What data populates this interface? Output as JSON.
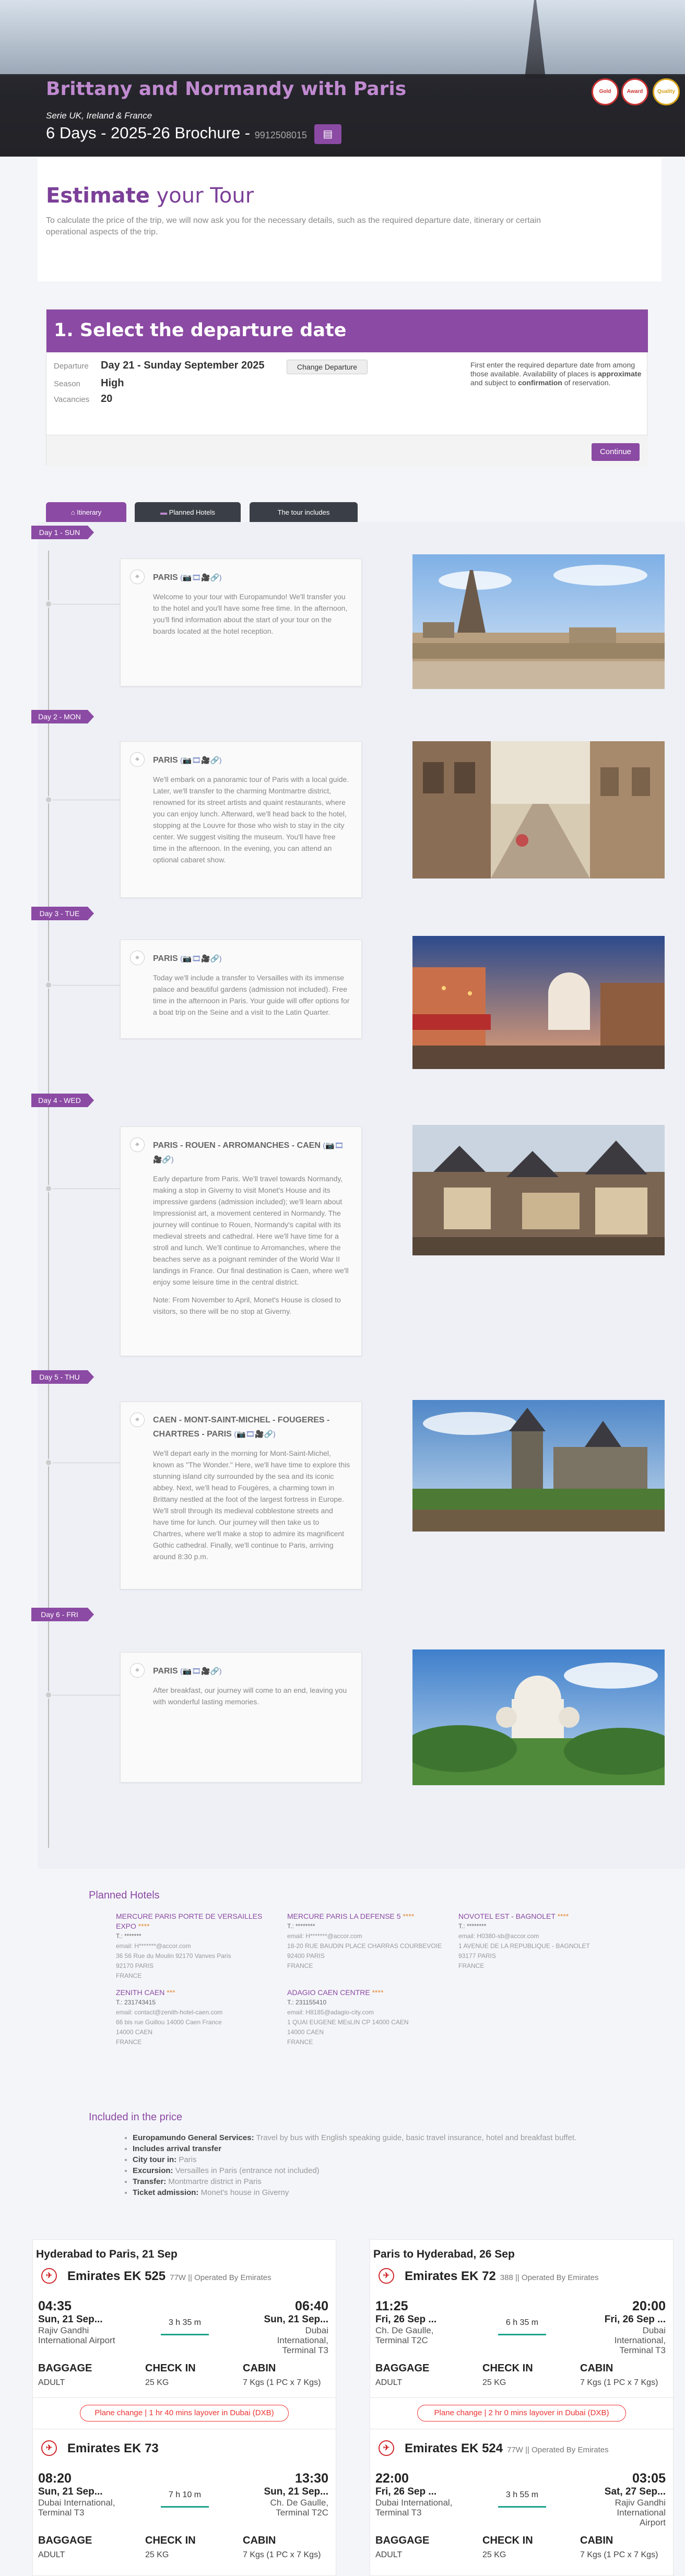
{
  "hero": {
    "title": "Brittany and Normandy with Paris",
    "subtitle": "Serie UK, Ireland & France",
    "days": "6 Days - 2025-26 Brochure -",
    "code": "9912508015",
    "badges": [
      "Gold",
      "Award",
      "Quality"
    ]
  },
  "estimate": {
    "title_bold": "Estimate",
    "title_rest": " your Tour",
    "text": "To calculate the price of the trip, we will now ask you for the necessary details, such as the required departure date, itinerary or certain operational aspects of the trip."
  },
  "departure": {
    "heading": "1. Select the departure date",
    "departure_label": "Departure",
    "departure_value": "Day 21 - Sunday September 2025",
    "change_button": "Change Departure",
    "season_label": "Season",
    "season_value": "High",
    "vacancies_label": "Vacancies",
    "vacancies_value": "20",
    "note_pre": "First enter the required departure date from among those available. Availability of places is ",
    "note_b1": "approximate",
    "note_mid": " and subject to ",
    "note_b2": "confirmation",
    "note_post": " of reservation.",
    "continue_button": "Continue"
  },
  "tabs": [
    {
      "label": "Itinerary"
    },
    {
      "label": "Planned Hotels"
    },
    {
      "label": "The tour includes"
    }
  ],
  "days": [
    {
      "label": "Day 1 - SUN",
      "city": "PARIS",
      "text": "Welcome to your tour with Europamundo! We'll transfer you to the hotel and you'll have some free time. In the afternoon, you'll find information about the start of your tour on the boards located at the hotel reception."
    },
    {
      "label": "Day 2 - MON",
      "city": "PARIS",
      "text": "We'll embark on a panoramic tour of Paris with a local guide. Later, we'll transfer to the charming Montmartre district, renowned for its street artists and quaint restaurants, where you can enjoy lunch. Afterward, we'll head back to the hotel, stopping at the Louvre for those who wish to stay in the city center. We suggest visiting the museum. You'll have free time in the afternoon. In the evening, you can attend an optional cabaret show."
    },
    {
      "label": "Day 3 - TUE",
      "city": "PARIS",
      "text": "Today we'll include a transfer to Versailles with its immense palace and beautiful gardens (admission not included). Free time in the afternoon in Paris. Your guide will offer options for a boat trip on the Seine and a visit to the Latin Quarter."
    },
    {
      "label": "Day 4 - WED",
      "city": "PARIS - ROUEN - ARROMANCHES - CAEN",
      "text": "Early departure from Paris. We'll travel towards Normandy, making a stop in Giverny to visit Monet's House and its impressive gardens (admission included); we'll learn about Impressionist art, a movement centered in Normandy. The journey will continue to Rouen, Normandy's capital with its medieval streets and cathedral. Here we'll have time for a stroll and lunch. We'll continue to Arromanches, where the beaches serve as a poignant reminder of the World War II landings in France. Our final destination is Caen, where we'll enjoy some leisure time in the central district.",
      "note": "Note: From November to April, Monet's House is closed to visitors, so there will be no stop at Giverny."
    },
    {
      "label": "Day 5 - THU",
      "city": "CAEN - MONT-SAINT-MICHEL - FOUGERES - CHARTRES - PARIS",
      "text": "We'll depart early in the morning for Mont-Saint-Michel, known as \"The Wonder.\" Here, we'll have time to explore this stunning island city surrounded by the sea and its iconic abbey. Next, we'll head to Fougères, a charming town in Brittany nestled at the foot of the largest fortress in Europe. We'll stroll through its medieval cobblestone streets and have time for lunch. Our journey will then take us to Chartres, where we'll make a stop to admire its magnificent Gothic cathedral. Finally, we'll continue to Paris, arriving around 8:30 p.m."
    },
    {
      "label": "Day 6 - FRI",
      "city": "PARIS",
      "text": "After breakfast, our journey will come to an end, leaving you with wonderful lasting memories."
    }
  ],
  "hotels": {
    "title": "Planned Hotels",
    "items": [
      {
        "name": "MERCURE PARIS PORTE DE VERSAILLES EXPO",
        "stars": "****",
        "tel": "T.: *******",
        "email": "email: H*******@accor.com",
        "addr1": "36 56 Rue du Moulin 92170 Vanves Paris",
        "addr2": "92170 PARIS",
        "country": "FRANCE"
      },
      {
        "name": "MERCURE PARIS LA DEFENSE 5",
        "stars": "****",
        "tel": "T.: ********",
        "email": "email: H*******@accor.com",
        "addr1": "18-20 RUE BAUDIN PLACE CHARRAS COURBEVOIE",
        "addr2": "92400 PARIS",
        "country": "FRANCE"
      },
      {
        "name": "NOVOTEL EST - BAGNOLET",
        "stars": "****",
        "tel": "T.: ********",
        "email": "email: H0380-sb@accor.com",
        "addr1": "1 AVENUE DE LA REPUBLIQUE - BAGNOLET",
        "addr2": "93177 PARIS",
        "country": "FRANCE"
      },
      {
        "name": "ZENITH CAEN",
        "stars": "***",
        "tel": "T.: 231743415",
        "email": "email: contact@zenith-hotel-caen.com",
        "addr1": "66 bis rue Guillou 14000 Caen France",
        "addr2": "14000 CAEN",
        "country": "FRANCE"
      },
      {
        "name": "ADAGIO CAEN CENTRE",
        "stars": "****",
        "tel": "T.: 231155410",
        "email": "email: H8185@adagio-city.com",
        "addr1": "1 QUAI EUGENE MEsLIN CP 14000 CAEN",
        "addr2": "14000 CAEN",
        "country": "FRANCE"
      }
    ]
  },
  "included": {
    "title": "Included in the price",
    "items": [
      {
        "label": "Europamundo General Services:",
        "value": "Travel by bus with English speaking guide, basic travel insurance, hotel and breakfast buffet."
      },
      {
        "label": "Includes arrival transfer",
        "value": ""
      },
      {
        "label": "City tour in:",
        "value": "Paris"
      },
      {
        "label": "Excursion:",
        "value": "Versailles in Paris (entrance not included)"
      },
      {
        "label": "Transfer:",
        "value": "Montmartre district in Paris"
      },
      {
        "label": "Ticket admission:",
        "value": "Monet's house in Giverny"
      }
    ]
  },
  "flights": [
    {
      "heading": "Hyderabad to Paris, 21 Sep",
      "layover": "Plane change | 1 hr 40 mins layover in Dubai (DXB)",
      "legs": [
        {
          "airline": "Emirates EK 525",
          "meta": "77W || Operated By Emirates",
          "dep_time": "04:35",
          "dep_date": "Sun, 21 Sep...",
          "dep_place": "Rajiv Gandhi International Airport",
          "duration": "3 h 35 m",
          "arr_time": "06:40",
          "arr_date": "Sun, 21 Sep...",
          "arr_place": "Dubai International, Terminal T3",
          "baggage_h": "BAGGAGE",
          "checkin_h": "CHECK IN",
          "cabin_h": "CABIN",
          "baggage": "ADULT",
          "checkin": "25 KG",
          "cabin": "7 Kgs (1 PC x 7 Kgs)"
        },
        {
          "airline": "Emirates EK 73",
          "meta": "",
          "dep_time": "08:20",
          "dep_date": "Sun, 21 Sep...",
          "dep_place": "Dubai International, Terminal T3",
          "duration": "7 h 10 m",
          "arr_time": "13:30",
          "arr_date": "Sun, 21 Sep...",
          "arr_place": "Ch. De Gaulle, Terminal T2C",
          "baggage_h": "BAGGAGE",
          "checkin_h": "CHECK IN",
          "cabin_h": "CABIN",
          "baggage": "ADULT",
          "checkin": "25 KG",
          "cabin": "7 Kgs (1 PC x 7 Kgs)"
        }
      ]
    },
    {
      "heading": "Paris to Hyderabad, 26 Sep",
      "layover": "Plane change | 2 hr 0 mins layover in Dubai (DXB)",
      "legs": [
        {
          "airline": "Emirates EK 72",
          "meta": "388 || Operated By Emirates",
          "dep_time": "11:25",
          "dep_date": "Fri, 26 Sep ...",
          "dep_place": "Ch. De Gaulle, Terminal T2C",
          "duration": "6 h 35 m",
          "arr_time": "20:00",
          "arr_date": "Fri, 26 Sep ...",
          "arr_place": "Dubai International, Terminal T3",
          "baggage_h": "BAGGAGE",
          "checkin_h": "CHECK IN",
          "cabin_h": "CABIN",
          "baggage": "ADULT",
          "checkin": "25 KG",
          "cabin": "7 Kgs (1 PC x 7 Kgs)"
        },
        {
          "airline": "Emirates EK 524",
          "meta": "77W || Operated By Emirates",
          "dep_time": "22:00",
          "dep_date": "Fri, 26 Sep ...",
          "dep_place": "Dubai International, Terminal T3",
          "duration": "3 h 55 m",
          "arr_time": "03:05",
          "arr_date": "Sat, 27 Sep...",
          "arr_place": "Rajiv Gandhi International Airport",
          "baggage_h": "BAGGAGE",
          "checkin_h": "CHECK IN",
          "cabin_h": "CABIN",
          "baggage": "ADULT",
          "checkin": "25 KG",
          "cabin": "7 Kgs (1 PC x 7 Kgs)"
        }
      ]
    }
  ],
  "colors": {
    "brand": "#8b4aa3",
    "accent_green": "#1ca28c",
    "airline_red": "#d0282d"
  },
  "icons": {
    "map_pin": "map-pin-icon",
    "home": "home-icon",
    "pdf": "file-pdf-icon",
    "media": "media-icons"
  },
  "media_icons_text": "(📷🎞🎥🔗)"
}
